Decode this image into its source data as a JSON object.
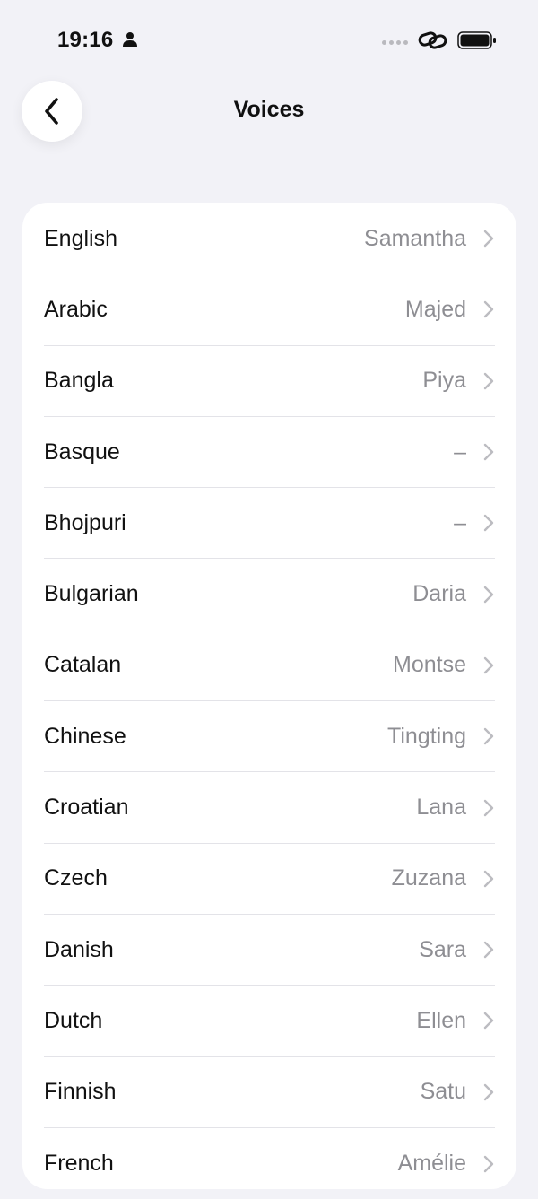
{
  "status_bar": {
    "time": "19:16"
  },
  "header": {
    "title": "Voices"
  },
  "voices": [
    {
      "language": "English",
      "voice": "Samantha"
    },
    {
      "language": "Arabic",
      "voice": "Majed"
    },
    {
      "language": "Bangla",
      "voice": "Piya"
    },
    {
      "language": "Basque",
      "voice": "–"
    },
    {
      "language": "Bhojpuri",
      "voice": "–"
    },
    {
      "language": "Bulgarian",
      "voice": "Daria"
    },
    {
      "language": "Catalan",
      "voice": "Montse"
    },
    {
      "language": "Chinese",
      "voice": "Tingting"
    },
    {
      "language": "Croatian",
      "voice": "Lana"
    },
    {
      "language": "Czech",
      "voice": "Zuzana"
    },
    {
      "language": "Danish",
      "voice": "Sara"
    },
    {
      "language": "Dutch",
      "voice": "Ellen"
    },
    {
      "language": "Finnish",
      "voice": "Satu"
    },
    {
      "language": "French",
      "voice": "Amélie"
    }
  ],
  "icons": {
    "back": "chevron-left-icon",
    "row_chevron": "chevron-right-icon",
    "person": "person-icon",
    "link": "link-icon",
    "battery": "battery-icon"
  }
}
